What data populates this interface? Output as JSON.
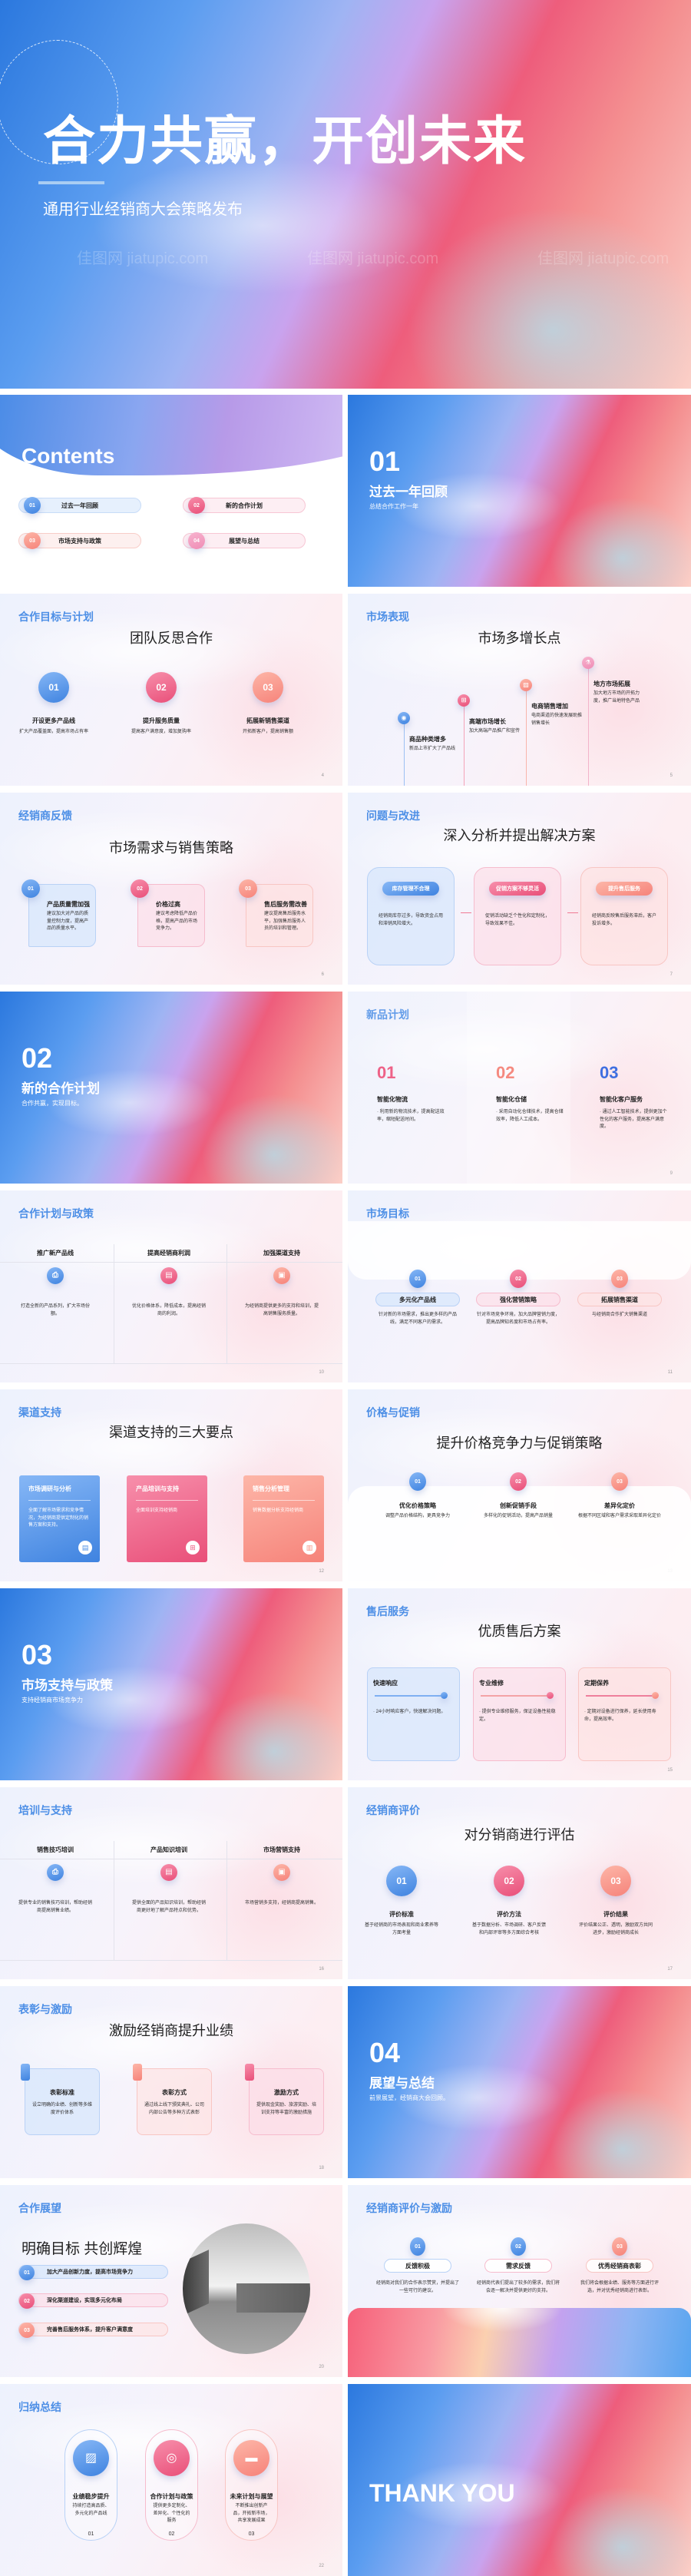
{
  "watermark": "佳图网 jiatupic.com",
  "colors": {
    "blue": "#4d8fe6",
    "pink": "#ee6287",
    "salmon": "#f99586",
    "rose": "#f19bbd"
  },
  "cover": {
    "title": "合力共赢，开创未来",
    "subtitle": "通用行业经销商大会策略发布"
  },
  "slides": [
    {
      "type": "contents",
      "title": "Contents",
      "items": [
        {
          "num": "01",
          "label": "过去一年回顾"
        },
        {
          "num": "02",
          "label": "新的合作计划"
        },
        {
          "num": "03",
          "label": "市场支持与政策"
        },
        {
          "num": "04",
          "label": "展望与总结"
        }
      ]
    },
    {
      "type": "section",
      "num": "01",
      "title": "过去一年回顾",
      "sub": "总结合作工作一年"
    },
    {
      "type": "circles",
      "tag": "合作目标与计划",
      "title": "团队反思合作",
      "page": "4",
      "items": [
        {
          "num": "01",
          "h": "开设更多产品线",
          "t": "扩大产品覆盖面，提高市场占有率"
        },
        {
          "num": "02",
          "h": "提升服务质量",
          "t": "提高客户满意度，增加复购率"
        },
        {
          "num": "03",
          "h": "拓展新销售渠道",
          "t": "开拓新客户，提高销售额"
        }
      ]
    },
    {
      "type": "timeline",
      "tag": "市场表现",
      "title": "市场多增长点",
      "page": "5",
      "items": [
        {
          "icon": "location-icon",
          "h": "商品种类增多",
          "t": "新品上市扩大了产品线"
        },
        {
          "icon": "sitemap-icon",
          "h": "高端市场增长",
          "t": "加大高端产品推广和宣传"
        },
        {
          "icon": "image-icon",
          "h": "电商销售增加",
          "t": "电商渠道的快速发展助推销售增长"
        },
        {
          "icon": "flask-icon",
          "h": "地方市场拓展",
          "t": "加大地方市场的开拓力度，推广当地特色产品"
        }
      ]
    },
    {
      "type": "numcards",
      "tag": "经销商反馈",
      "title": "市场需求与销售策略",
      "page": "6",
      "items": [
        {
          "num": "01",
          "h": "产品质量需加强",
          "t": "建议加大对产品的质量控制力度，提高产品的质量水平。"
        },
        {
          "num": "02",
          "h": "价格过高",
          "t": "建议考虑降低产品价格，提高产品的市场竞争力。"
        },
        {
          "num": "03",
          "h": "售后服务需改善",
          "t": "建议提高售后服务水平，加强售后服务人员的培训和管理。"
        }
      ]
    },
    {
      "type": "pillcards",
      "tag": "问题与改进",
      "title": "深入分析并提出解决方案",
      "page": "7",
      "items": [
        {
          "h": "库存管理不合理",
          "t": "经销商库存过多，导致资金占用和滞销风险增大。"
        },
        {
          "h": "促销方案不够灵活",
          "t": "促销活动缺乏个性化和定制化，导致效果不佳。"
        },
        {
          "h": "提升售后服务",
          "t": "经销商反映售后服务滞后，客户投诉增多。"
        }
      ]
    },
    {
      "type": "section",
      "num": "02",
      "title": "新的合作计划",
      "sub": "合作共赢，实现目标。"
    },
    {
      "type": "columns",
      "tag": "新品计划",
      "page": "9",
      "items": [
        {
          "num": "01",
          "h": "智能化物流",
          "t": "· 利用新的物流技术，提高配送效率，缩短配送时间。"
        },
        {
          "num": "02",
          "h": "智能化仓储",
          "t": "· 采用自动化仓储技术，提高仓储效率，降低人工成本。"
        },
        {
          "num": "03",
          "h": "智能化客户服务",
          "t": "· 通过人工智能技术，提供更加个性化的客户服务，提高客户满意度。"
        }
      ]
    },
    {
      "type": "table",
      "tag": "合作计划与政策",
      "page": "10",
      "items": [
        {
          "icon": "printer-icon",
          "h": "推广新产品线",
          "t": "打造全新的产品系列，扩大市场份额。"
        },
        {
          "icon": "box-icon",
          "h": "提高经销商利润",
          "t": "优化价格体系，降低成本，提高经销商的利润。"
        },
        {
          "icon": "bag-icon",
          "h": "加强渠道支持",
          "t": "为经销商提供更多的支持和培训，提高销售服务质量。"
        }
      ]
    },
    {
      "type": "pills3",
      "tag": "市场目标",
      "page": "11",
      "items": [
        {
          "num": "01",
          "h": "多元化产品线",
          "t": "针对新的市场需求，推出更多样的产品线，满足不同客户的需求。"
        },
        {
          "num": "02",
          "h": "强化营销策略",
          "t": "针对市场竞争环境，加大品牌营销力度，提高品牌知名度和市场占有率。"
        },
        {
          "num": "03",
          "h": "拓展销售渠道",
          "t": "与经销商合作扩大销售渠道"
        }
      ]
    },
    {
      "type": "colorcards",
      "tag": "渠道支持",
      "title": "渠道支持的三大要点",
      "page": "12",
      "items": [
        {
          "icon": "document-icon",
          "h": "市场调研与分析",
          "t": "全面了解市场需求和竞争情况，为经销商提供定制化的销售方案和支持。"
        },
        {
          "icon": "sitemap-icon",
          "h": "产品培训与支持",
          "t": "全面培训支持经销商"
        },
        {
          "icon": "chart-icon",
          "h": "销售分析管理",
          "t": "销售数据分析支持经销商"
        }
      ]
    },
    {
      "type": "band",
      "tag": "价格与促销",
      "title": "提升价格竞争力与促销策略",
      "page": "13",
      "items": [
        {
          "num": "01",
          "h": "优化价格策略",
          "t": "调整产品价格结构，更具竞争力"
        },
        {
          "num": "02",
          "h": "创新促销手段",
          "t": "多样化的促销活动，提高产品销量"
        },
        {
          "num": "03",
          "h": "差异化定价",
          "t": "根据不同区域和客户需求采取差异化定价"
        }
      ]
    },
    {
      "type": "section",
      "num": "03",
      "title": "市场支持与政策",
      "sub": "支持经销商市场竞争力"
    },
    {
      "type": "sliders",
      "tag": "售后服务",
      "title": "优质售后方案",
      "page": "15",
      "items": [
        {
          "h": "快速响应",
          "t": "· 24小时响应客户，快速解决问题。"
        },
        {
          "h": "专业维修",
          "t": "· 提供专业维修服务，保证设备性能稳定。"
        },
        {
          "h": "定期保养",
          "t": "· 定期对设备进行保养，延长使用寿命，提高效率。"
        }
      ]
    },
    {
      "type": "table",
      "tag": "培训与支持",
      "page": "16",
      "items": [
        {
          "icon": "printer-icon",
          "h": "销售技巧培训",
          "t": "提供专业的销售技巧培训，帮助经销商提高销售业绩。"
        },
        {
          "icon": "box-icon",
          "h": "产品知识培训",
          "t": "提供全面的产品知识培训，帮助经销商更好地了解产品特点和优势。"
        },
        {
          "icon": "bag-icon",
          "h": "市场营销支持",
          "t": "市场营销多支持，经销商提高销售。"
        }
      ]
    },
    {
      "type": "circles",
      "tag": "经销商评价",
      "title": "对分销商进行评估",
      "page": "17",
      "items": [
        {
          "num": "01",
          "h": "评价标准",
          "t": "基于经销商的市场表现和商业素养等方面考量"
        },
        {
          "num": "02",
          "h": "评价方法",
          "t": "基于数据分析、市场调研、客户反馈和内部评审等多方面综合考核"
        },
        {
          "num": "03",
          "h": "评价结果",
          "t": "评价结果公正、透明，激励双方共同进步，激励经销商成长"
        }
      ]
    },
    {
      "type": "tabcards",
      "tag": "表彰与激励",
      "title": "激励经销商提升业绩",
      "page": "18",
      "items": [
        {
          "h": "表彰标准",
          "t": "设立明确的业绩、创新等多维度评价体系"
        },
        {
          "h": "表彰方式",
          "t": "通过线上线下颁奖典礼、公司内部公告等多种方式表彰"
        },
        {
          "h": "激励方式",
          "t": "提供现金奖励、旅游奖励、培训支持等丰富的激励措施"
        }
      ]
    },
    {
      "type": "section",
      "num": "04",
      "title": "展望与总结",
      "sub": "前景展望，经销商大会回顾。"
    },
    {
      "type": "photo",
      "tag": "合作展望",
      "title": "明确目标 共创辉煌",
      "page": "20",
      "items": [
        {
          "num": "01",
          "t": "加大产品创新力度，提高市场竞争力"
        },
        {
          "num": "02",
          "t": "深化渠道建设，实现多元化布局"
        },
        {
          "num": "03",
          "t": "完善售后服务体系，提升客户满意度"
        }
      ]
    },
    {
      "type": "pills3b",
      "tag": "经销商评价与激励",
      "page": "21",
      "items": [
        {
          "num": "01",
          "h": "反馈积极",
          "t": "经销商对我们的合作表示赞赏，并提出了一些可行的建议。"
        },
        {
          "num": "02",
          "h": "需求反馈",
          "t": "经销商代表们提出了较多的需求，我们将会逐一解决并提供更好的支持。"
        },
        {
          "num": "03",
          "h": "优秀经销商表彰",
          "t": "我们将会根据业绩、服务等方面进行评选，并对优秀经销商进行表彰。"
        }
      ]
    },
    {
      "type": "capsules",
      "tag": "归纳总结",
      "page": "22",
      "items": [
        {
          "icon": "image-icon",
          "num": "01",
          "h": "业绩稳步提升",
          "t": "持续打造高品质、多元化的产品线"
        },
        {
          "icon": "webcam-icon",
          "num": "02",
          "h": "合作计划与政策",
          "t": "提供更多定制化、差异化、个性化的服务"
        },
        {
          "icon": "armchair-icon",
          "num": "03",
          "h": "未来计划与展望",
          "t": "不断推出创新产品，开拓新市场，共享发展成果"
        }
      ]
    },
    {
      "type": "thanks",
      "title": "THANK YOU"
    }
  ]
}
